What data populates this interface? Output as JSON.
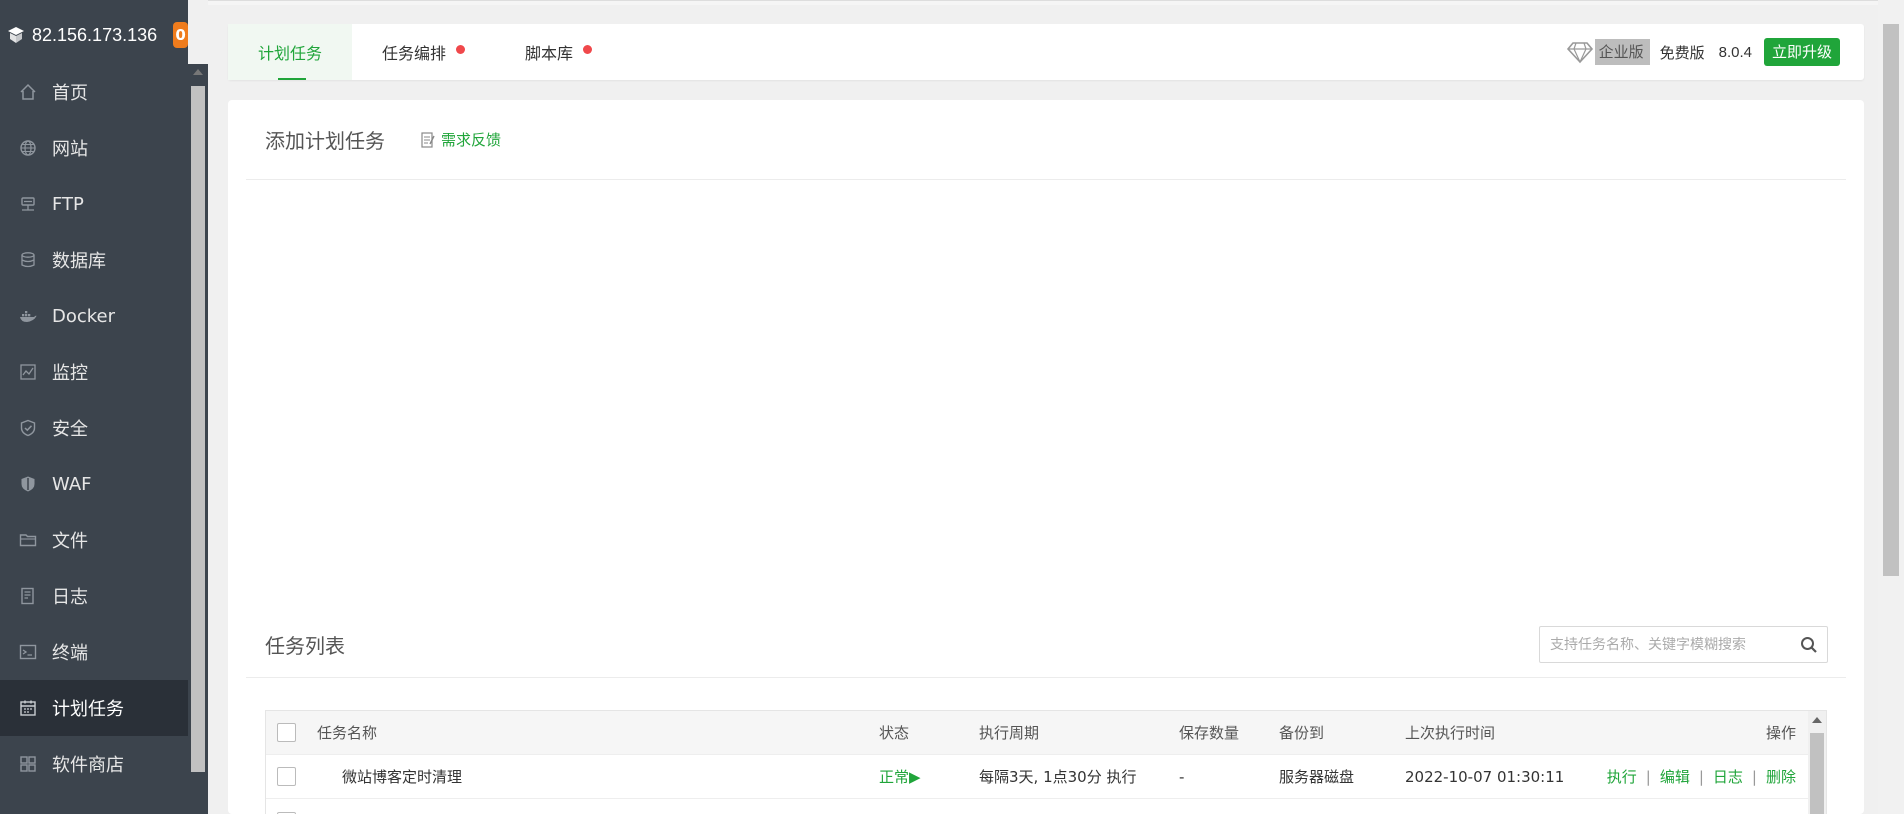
{
  "sidebar": {
    "host": "82.156.173.136",
    "badge": "0",
    "items": [
      {
        "label": "首页",
        "icon": "home-icon"
      },
      {
        "label": "网站",
        "icon": "globe-icon"
      },
      {
        "label": "FTP",
        "icon": "ftp-icon"
      },
      {
        "label": "数据库",
        "icon": "database-icon"
      },
      {
        "label": "Docker",
        "icon": "docker-icon"
      },
      {
        "label": "监控",
        "icon": "monitor-icon"
      },
      {
        "label": "安全",
        "icon": "shield-icon"
      },
      {
        "label": "WAF",
        "icon": "waf-icon"
      },
      {
        "label": "文件",
        "icon": "folder-icon"
      },
      {
        "label": "日志",
        "icon": "log-icon"
      },
      {
        "label": "终端",
        "icon": "terminal-icon"
      },
      {
        "label": "计划任务",
        "icon": "calendar-icon"
      },
      {
        "label": "软件商店",
        "icon": "apps-icon"
      }
    ],
    "active_index": 11
  },
  "tabs": [
    {
      "label": "计划任务",
      "active": true,
      "dot": false
    },
    {
      "label": "任务编排",
      "active": false,
      "dot": true
    },
    {
      "label": "脚本库",
      "active": false,
      "dot": true
    }
  ],
  "header": {
    "enterprise_label": "企业版",
    "free_label": "免费版",
    "version": "8.0.4",
    "upgrade_label": "立即升级"
  },
  "add_section": {
    "title": "添加计划任务",
    "feedback_label": "需求反馈"
  },
  "list_section": {
    "title": "任务列表",
    "search_placeholder": "支持任务名称、关键字模糊搜索"
  },
  "table": {
    "columns": [
      "任务名称",
      "状态",
      "执行周期",
      "保存数量",
      "备份到",
      "上次执行时间",
      "操作"
    ],
    "rows": [
      {
        "name": "微站博客定时清理",
        "status": "正常▶",
        "period": "每隔3天, 1点30分 执行",
        "keep": "-",
        "backup": "服务器磁盘",
        "last": "2022-10-07 01:30:11",
        "ops": [
          "执行",
          "编辑",
          "日志",
          "删除"
        ]
      }
    ]
  },
  "colors": {
    "accent": "#20a53a",
    "sidebar_bg": "#3c444d",
    "sidebar_active": "#2a3038",
    "badge": "#ef7c1d",
    "dot": "#f0484b"
  }
}
